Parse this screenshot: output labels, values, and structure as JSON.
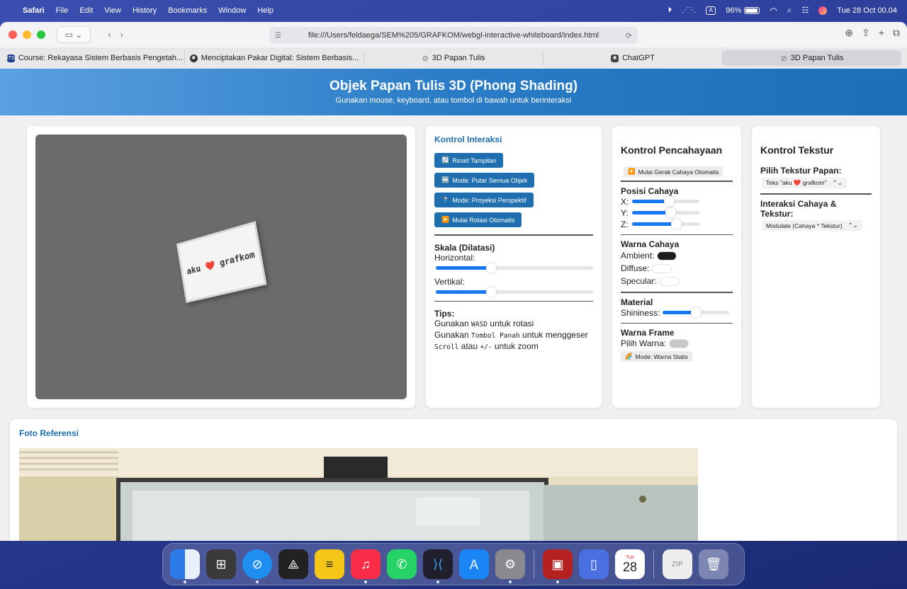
{
  "menubar": {
    "app": "Safari",
    "items": [
      "File",
      "Edit",
      "View",
      "History",
      "Bookmarks",
      "Window",
      "Help"
    ],
    "battery": "96%",
    "datetime": "Tue 28 Oct  00.04",
    "input_badge": "A"
  },
  "browser": {
    "url": "file:///Users/feldaega/SEM%205/GRAFKOM/webgl-interactive-whiteboard/index.html",
    "tabs": [
      {
        "label": "Course: Rekayasa Sistem Berbasis Pengetah...",
        "icon": "its-icon"
      },
      {
        "label": "Menciptakan Pakar Digital: Sistem Berbasis...",
        "icon": "openai-icon"
      },
      {
        "label": "3D Papan Tulis",
        "icon": "compass-icon"
      },
      {
        "label": "ChatGPT",
        "icon": "chatgpt-icon"
      },
      {
        "label": "3D Papan Tulis",
        "icon": "compass-icon"
      }
    ]
  },
  "page": {
    "title": "Objek Papan Tulis 3D (Phong Shading)",
    "subtitle": "Gunakan mouse, keyboard, atau tombol di bawah untuk berinteraksi",
    "board_text": "aku ❤️ grafkom",
    "interaksi": {
      "title": "Kontrol Interaksi",
      "buttons": [
        {
          "icon": "🔄",
          "label": "Reset Tampilan"
        },
        {
          "icon": "↔️",
          "label": "Mode: Putar Semua Objek"
        },
        {
          "icon": "🔭",
          "label": "Mode: Proyeksi Perspektif"
        },
        {
          "icon": "▶️",
          "label": "Mulai Rotasi Otomatis"
        }
      ],
      "skala_title": "Skala (Dilatasi)",
      "horizontal_label": "Horizontal:",
      "horizontal_value": 0.35,
      "vertikal_label": "Vertikal:",
      "vertikal_value": 0.35,
      "tips_title": "Tips:",
      "tip1_a": "Gunakan ",
      "tip1_code": "WASD",
      "tip1_b": " untuk rotasi",
      "tip2_a": "Gunakan ",
      "tip2_code": "Tombol Panah",
      "tip2_b": " untuk menggeser",
      "tip3_code": "Scroll",
      "tip3_b": " atau ",
      "tip3_code2": "+/-",
      "tip3_c": " untuk zoom"
    },
    "cahaya": {
      "title": "Kontrol Pencahayaan",
      "auto_button": "Mulai Gerak Cahaya Otomatis",
      "auto_icon": "▶️",
      "posisi_title": "Posisi Cahaya",
      "x_label": "X:",
      "x_value": 0.55,
      "y_label": "Y:",
      "y_value": 0.57,
      "z_label": "Z:",
      "z_value": 0.65,
      "warna_title": "Warna Cahaya",
      "ambient_label": "Ambient:",
      "ambient_color": "#1e1e1e",
      "diffuse_label": "Diffuse:",
      "diffuse_color": "#ffffff",
      "specular_label": "Specular:",
      "specular_color": "#ffffff",
      "material_title": "Material",
      "shininess_label": "Shininess:",
      "shininess_value": 0.5,
      "frame_title": "Warna Frame",
      "frame_label": "Pilih Warna:",
      "frame_color": "#c8c8c8",
      "frame_mode": "Mode: Warna Statis",
      "frame_mode_icon": "🌈"
    },
    "tekstur": {
      "title": "Kontrol Tekstur",
      "pilih_label": "Pilih Tekstur Papan:",
      "pilih_value": "Teks \"aku ❤️ grafkom\"",
      "interaksi_label": "Interaksi Cahaya & Tekstur:",
      "interaksi_value": "Modulate (Cahaya * Tekstur)"
    },
    "foto_title": "Foto Referensi"
  },
  "dock": {
    "calendar_day": "Tue",
    "calendar_date": "28"
  },
  "colors": {
    "accent": "#1f6fb0",
    "slider": "#1877f2"
  }
}
